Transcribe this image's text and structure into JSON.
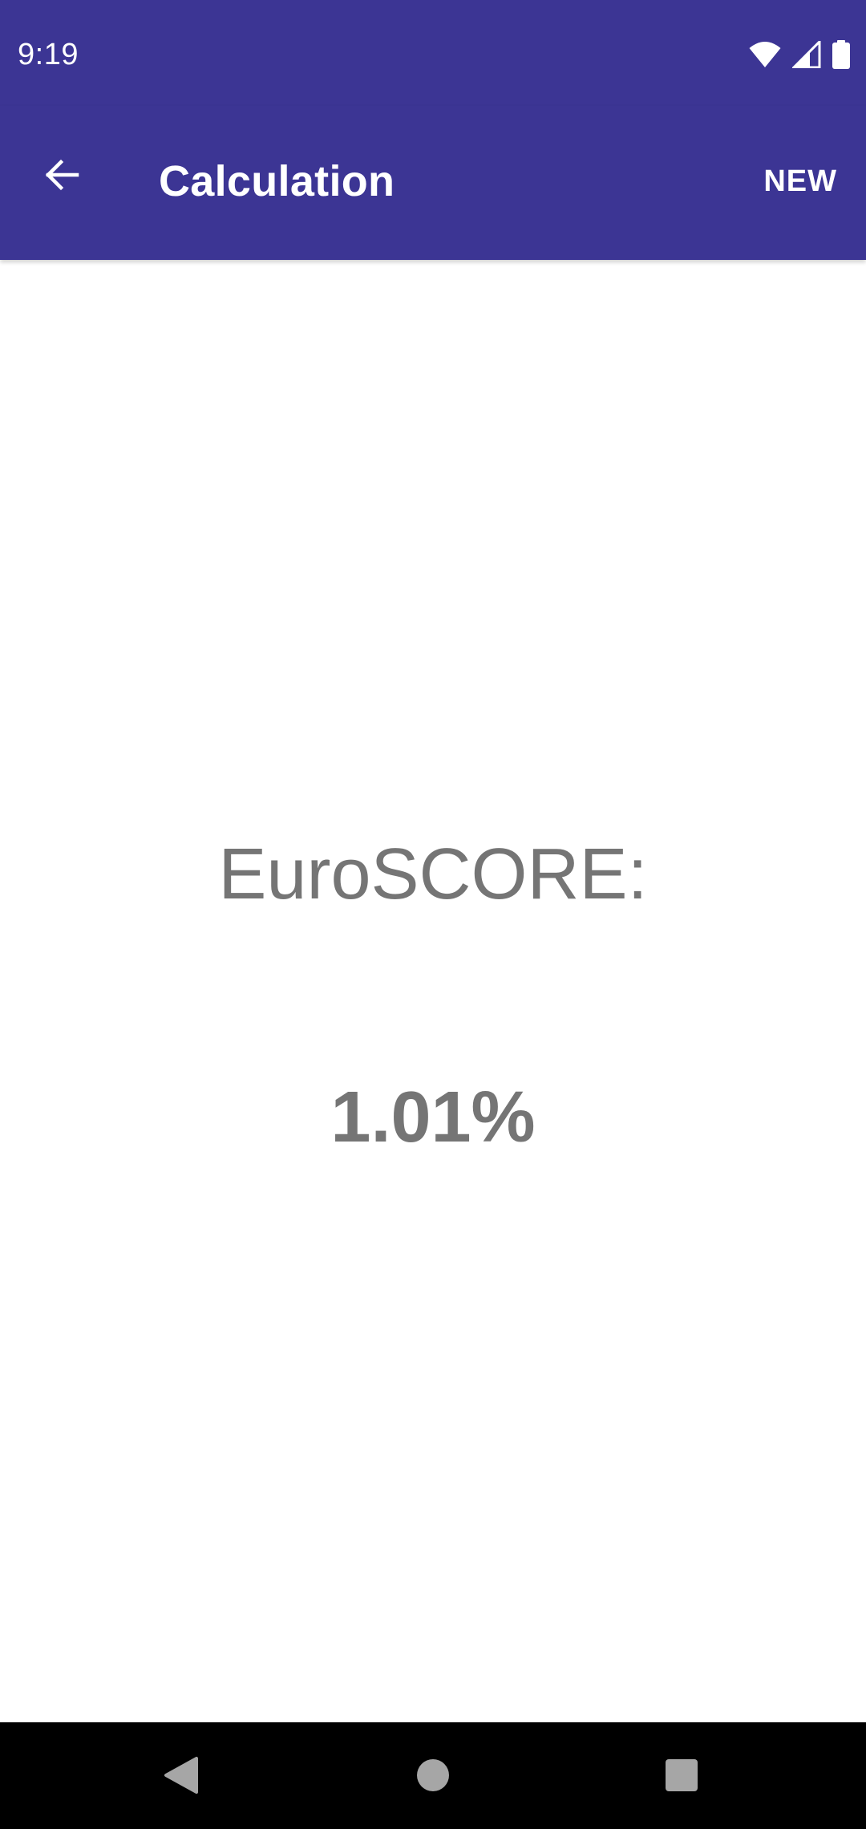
{
  "status_bar": {
    "time": "9:19",
    "icons": [
      "wifi-icon",
      "signal-icon",
      "battery-icon"
    ]
  },
  "app_bar": {
    "back_icon": "arrow-back-icon",
    "title": "Calculation",
    "action_label": "NEW"
  },
  "result": {
    "label": "EuroSCORE:",
    "value": "1.01%"
  },
  "nav_bar": {
    "icons": [
      "nav-back-icon",
      "nav-home-icon",
      "nav-recents-icon"
    ]
  },
  "colors": {
    "primary": "#3c3594",
    "result_text": "#757575",
    "on_primary": "#ffffff",
    "nav_background": "#000000",
    "nav_icon": "#a6a6a6"
  }
}
